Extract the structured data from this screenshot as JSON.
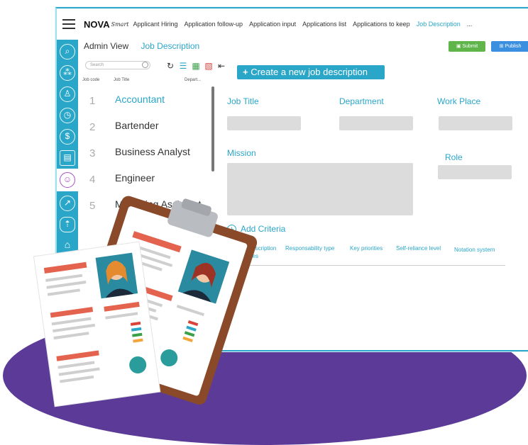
{
  "topnav": {
    "logo": "NOVA",
    "logo_sub": "Smart",
    "links": [
      "Applicant Hiring",
      "Application follow-up",
      "Application input",
      "Applications list",
      "Applications to keep",
      "Job Description",
      "..."
    ]
  },
  "header": {
    "admin_view": "Admin View",
    "job_description": "Job Description"
  },
  "buttons": {
    "submit": "Submit",
    "publish": "Publish"
  },
  "search": {
    "placeholder": "Search"
  },
  "list": {
    "col_code": "Job code",
    "col_title": "Job Title",
    "col_dept": "Depart...",
    "rows": [
      {
        "num": "1",
        "title": "Accountant"
      },
      {
        "num": "2",
        "title": "Bartender"
      },
      {
        "num": "3",
        "title": "Business Analyst"
      },
      {
        "num": "4",
        "title": "Engineer"
      },
      {
        "num": "5",
        "title": "Marketing Assistant"
      }
    ]
  },
  "form": {
    "create_label": "Create a new job description",
    "job_title": "Job Title",
    "department": "Department",
    "work_place": "Work Place",
    "mission": "Mission",
    "role": "Role",
    "add_criteria": "Add Criteria",
    "tabs": [
      "General description",
      "Responsability type",
      "Key priorities",
      "Self-reliance level",
      "Notation system",
      "...n activities"
    ]
  },
  "colors": {
    "accent": "#2aa6c9",
    "purple": "#5b3a98",
    "submit": "#5fb54a",
    "publish": "#3b8fe0"
  }
}
